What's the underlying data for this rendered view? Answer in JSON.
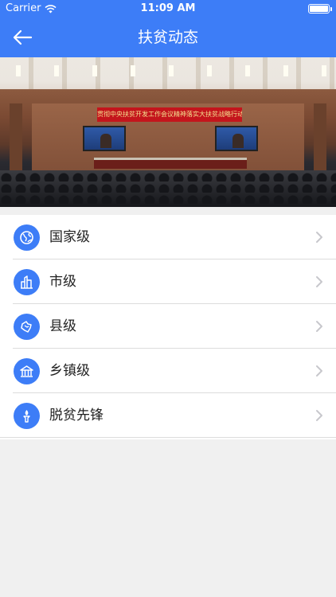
{
  "status": {
    "carrier": "Carrier",
    "time": "11:09 AM"
  },
  "nav": {
    "title": "扶贫动态"
  },
  "banner": {
    "sign_text": "贯彻中央扶贫开发工作会议精神落实大扶贫战略行动推进大会"
  },
  "menu": {
    "items": [
      {
        "label": "国家级",
        "icon": "globe-icon"
      },
      {
        "label": "市级",
        "icon": "city-buildings-icon"
      },
      {
        "label": "县级",
        "icon": "map-region-icon"
      },
      {
        "label": "乡镇级",
        "icon": "town-hall-icon"
      },
      {
        "label": "脱贫先锋",
        "icon": "torch-icon"
      }
    ]
  },
  "colors": {
    "accent": "#3d7df7",
    "background": "#f0f0f0",
    "row_bg": "#ffffff"
  }
}
